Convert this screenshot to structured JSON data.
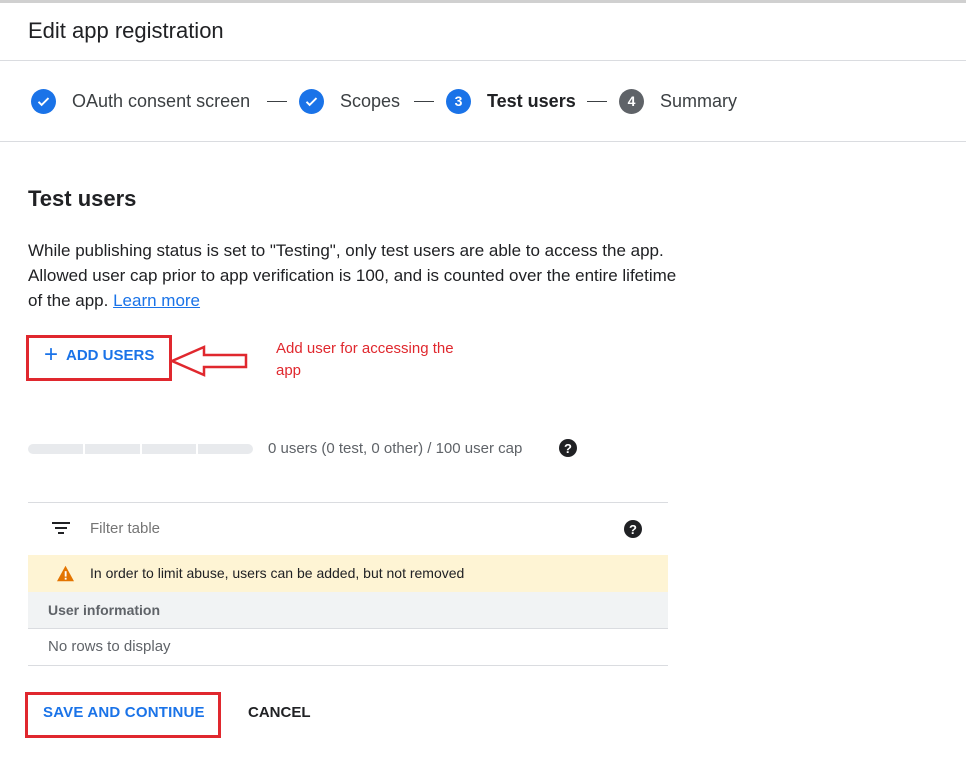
{
  "header": {
    "title": "Edit app registration"
  },
  "stepper": {
    "steps": [
      {
        "label": "OAuth consent screen",
        "state": "done",
        "number": ""
      },
      {
        "label": "Scopes",
        "state": "done",
        "number": ""
      },
      {
        "label": "Test users",
        "state": "active",
        "number": "3"
      },
      {
        "label": "Summary",
        "state": "todo",
        "number": "4"
      }
    ]
  },
  "section": {
    "title": "Test users",
    "description": "While publishing status is set to \"Testing\", only test users are able to access the app. Allowed user cap prior to app verification is 100, and is counted over the entire lifetime of the app.",
    "learn_more": "Learn more"
  },
  "add_users": {
    "label": "ADD USERS",
    "icon": "plus-icon"
  },
  "annotation": {
    "text": "Add user for accessing the app"
  },
  "user_cap": {
    "text": "0 users (0 test, 0 other) / 100 user cap",
    "fill_fraction": 0
  },
  "table": {
    "filter_placeholder": "Filter table",
    "warning": "In order to limit abuse, users can be added, but not removed",
    "columns": [
      "User information"
    ],
    "empty_text": "No rows to display"
  },
  "actions": {
    "save_label": "SAVE AND CONTINUE",
    "cancel_label": "CANCEL"
  },
  "colors": {
    "accent": "#1a73e8",
    "annotation_red": "#e0282e",
    "warning_bg": "#fef4d4",
    "warning_icon": "#e37400"
  }
}
